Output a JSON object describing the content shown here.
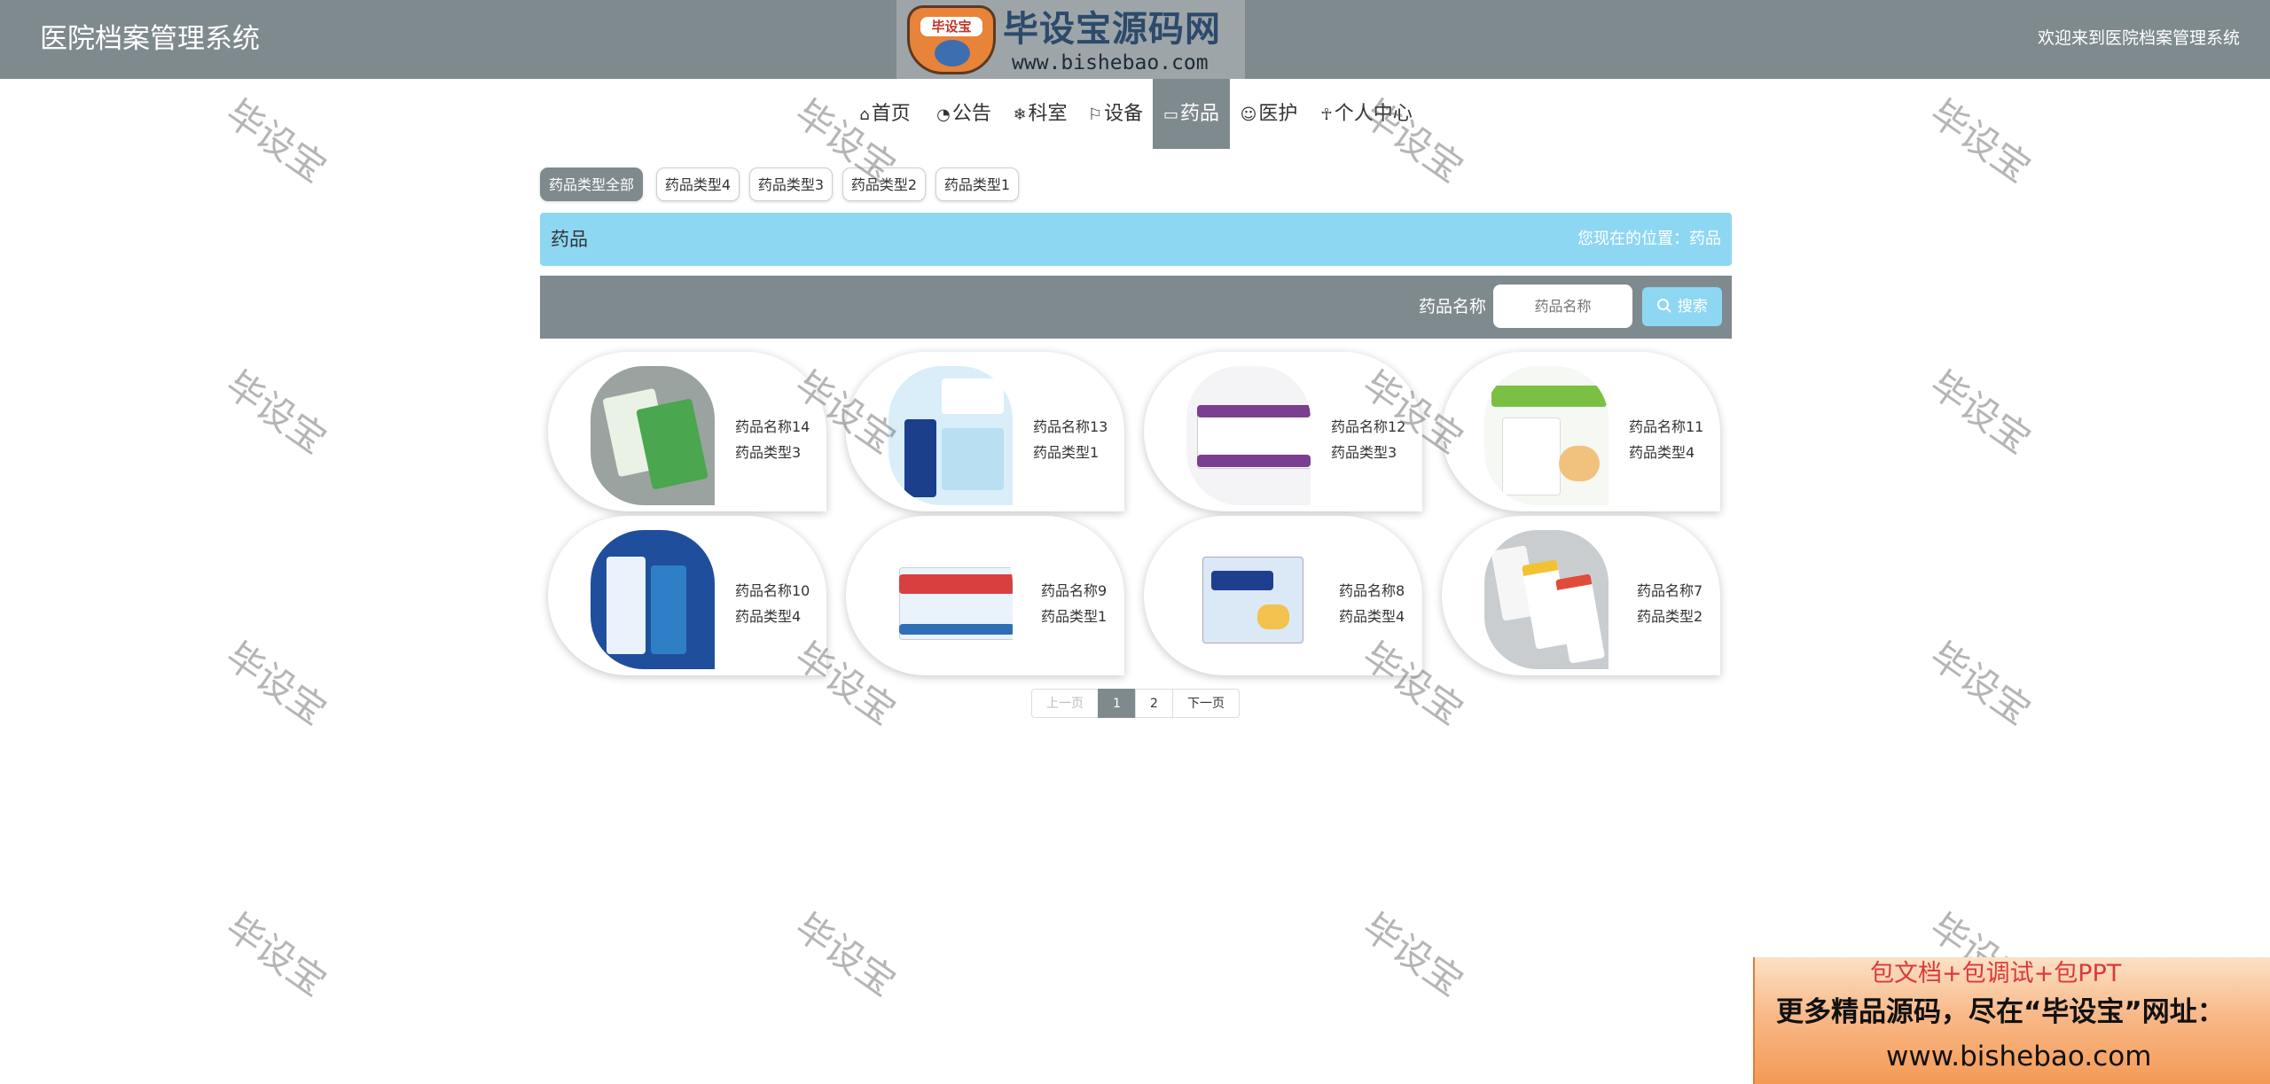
{
  "header": {
    "app_title": "医院档案管理系统",
    "welcome": "欢迎来到医院档案管理系统"
  },
  "logo": {
    "badge": "毕设宝",
    "name": "毕设宝源码网",
    "url": "www.bishebao.com"
  },
  "nav": {
    "items": [
      {
        "label": "首页",
        "icon": "home-icon",
        "glyph": "⌂"
      },
      {
        "label": "公告",
        "icon": "gauge-icon",
        "glyph": "◔"
      },
      {
        "label": "科室",
        "icon": "snowflake-icon",
        "glyph": "❄"
      },
      {
        "label": "设备",
        "icon": "flag-icon",
        "glyph": "⚐"
      },
      {
        "label": "药品",
        "icon": "book-icon",
        "glyph": "▭"
      },
      {
        "label": "医护",
        "icon": "smile-icon",
        "glyph": "☺"
      },
      {
        "label": "个人中心",
        "icon": "user-icon",
        "glyph": "☥"
      }
    ],
    "active_index": 4
  },
  "categories": {
    "items": [
      "药品类型全部",
      "药品类型4",
      "药品类型3",
      "药品类型2",
      "药品类型1"
    ],
    "active_index": 0
  },
  "title_bar": {
    "title": "药品",
    "location": "您现在的位置：药品"
  },
  "search": {
    "label": "药品名称",
    "placeholder": "药品名称",
    "button": "搜索",
    "button_icon": "search-icon"
  },
  "products": [
    {
      "name": "药品名称14",
      "type": "药品类型3"
    },
    {
      "name": "药品名称13",
      "type": "药品类型1"
    },
    {
      "name": "药品名称12",
      "type": "药品类型3"
    },
    {
      "name": "药品名称11",
      "type": "药品类型4"
    },
    {
      "name": "药品名称10",
      "type": "药品类型4"
    },
    {
      "name": "药品名称9",
      "type": "药品类型1"
    },
    {
      "name": "药品名称8",
      "type": "药品类型4"
    },
    {
      "name": "药品名称7",
      "type": "药品类型2"
    }
  ],
  "pagination": {
    "prev": "上一页",
    "pages": [
      "1",
      "2"
    ],
    "current": "1",
    "next": "下一页"
  },
  "watermark": "毕设宝",
  "ad": {
    "line1": "包文档+包调试+包PPT",
    "line2": "更多精品源码，尽在“毕设宝”网址：",
    "line3": "www.bishebao.com"
  },
  "colors": {
    "header_bg": "#7f8a8f",
    "accent_blue": "#8dd7f3"
  }
}
